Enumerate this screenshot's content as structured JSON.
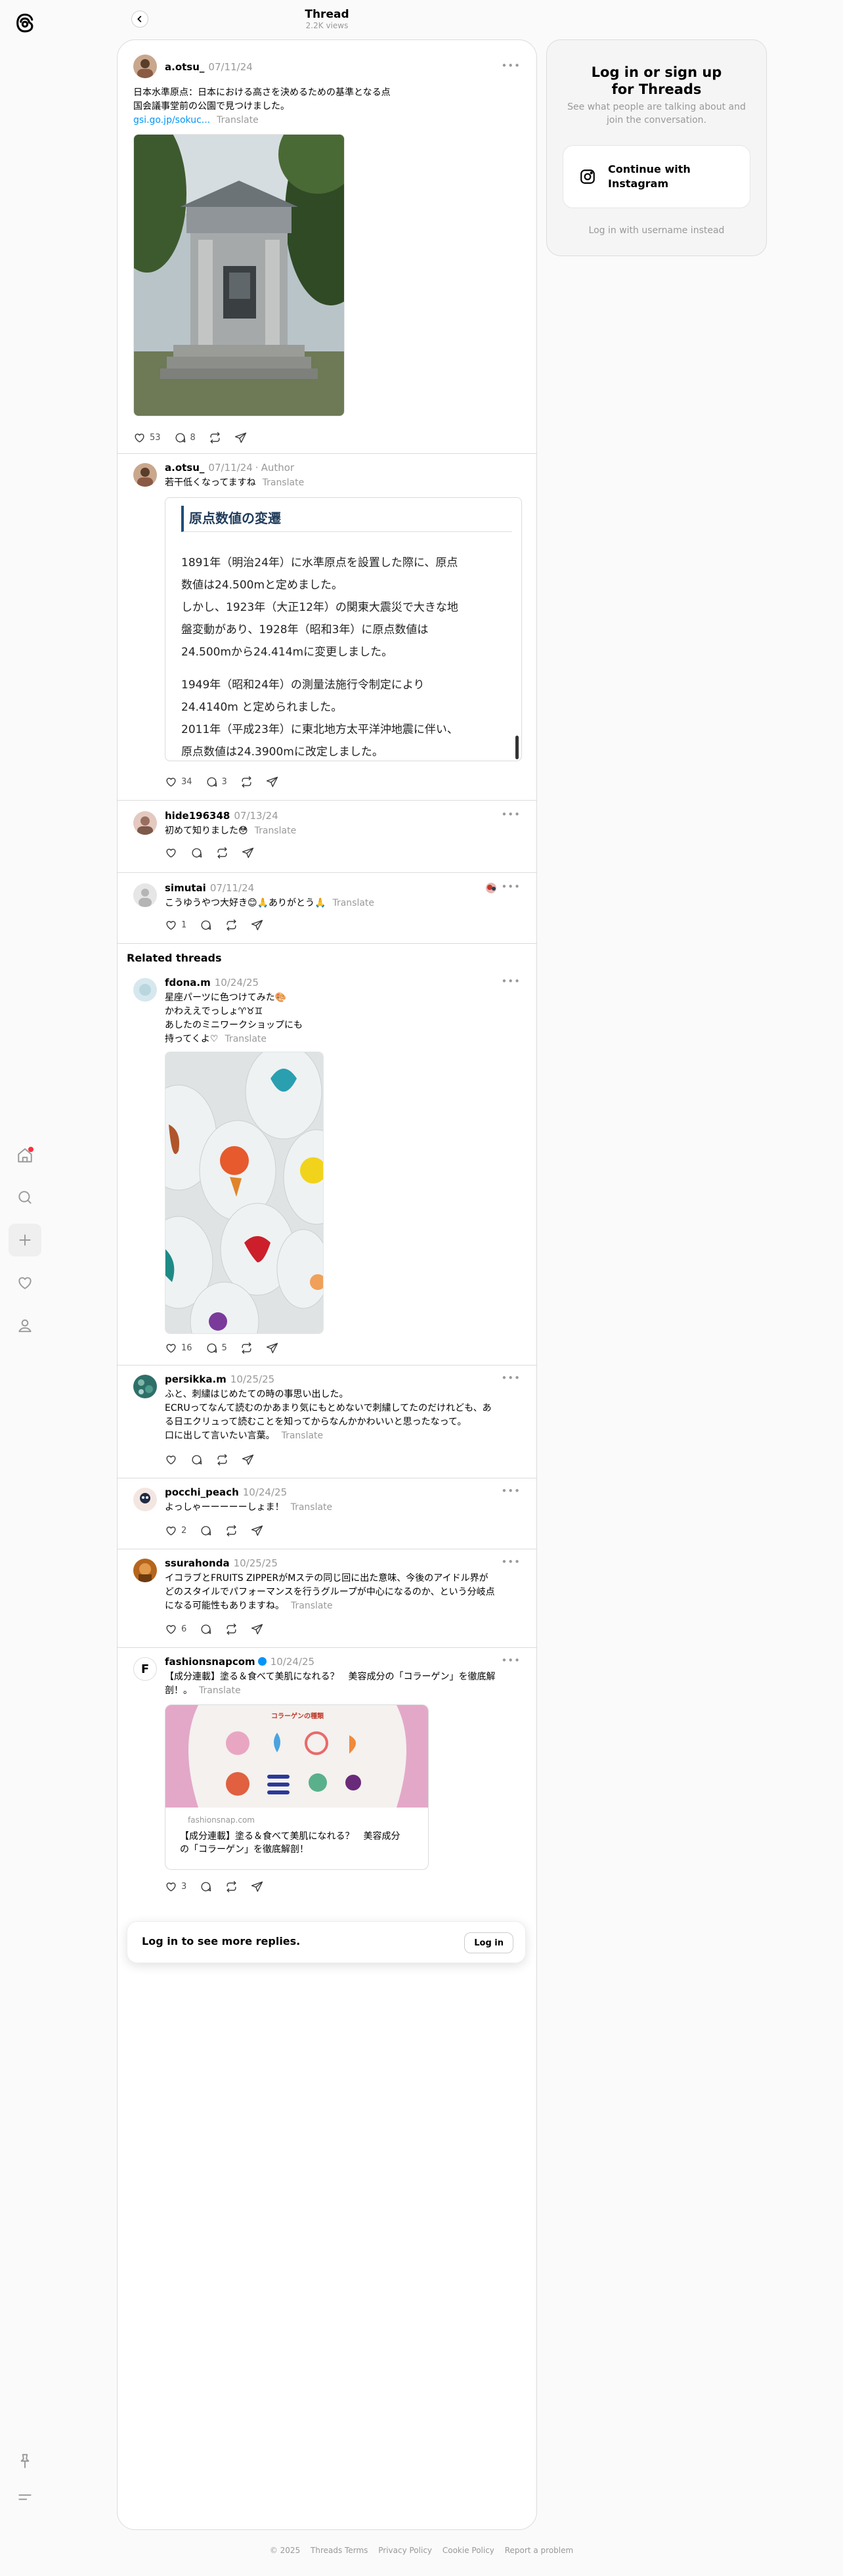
{
  "header": {
    "title": "Thread",
    "views": "2.2K views"
  },
  "nav": {
    "icons": [
      "threads-logo-icon",
      "home-icon",
      "search-icon",
      "create-icon",
      "activity-icon",
      "profile-icon",
      "pin-icon",
      "menu-icon"
    ]
  },
  "panel": {
    "title": "Log in or sign up for Threads",
    "subtitle": "See what people are talking about and join the conversation.",
    "ig_button": "Continue with Instagram",
    "alt_login": "Log in with username instead"
  },
  "main_post": {
    "username": "a.otsu_",
    "date": "07/11/24",
    "line1": "日本水準原点：日本における高さを決めるための基準となる点",
    "line2": "国会議事堂前の公園で見つけました。",
    "link": "gsi.go.jp/sokuc...",
    "translate": "Translate",
    "likes": "53",
    "replies": "8"
  },
  "author_reply": {
    "username": "a.otsu_",
    "date": "07/11/24",
    "tag": "Author",
    "text": "若干低くなってますね",
    "translate": "Translate",
    "quote_title": "原点数値の変遷",
    "quote_lines": [
      "1891年（明治24年）に水準原点を設置した際に、原点",
      "数値は24.500mと定めました。",
      "しかし、1923年（大正12年）の関東大震災で大きな地",
      "盤変動があり、1928年（昭和3年）に原点数値は",
      "24.500mから24.414mに変更しました。",
      "1949年（昭和24年）の測量法施行令制定により",
      "24.4140m と定められました。",
      "2011年（平成23年）に東北地方太平洋沖地震に伴い、",
      "原点数値は24.3900mに改定しました。"
    ],
    "likes": "34",
    "replies": "3"
  },
  "reply_hide": {
    "username": "hide196348",
    "date": "07/13/24",
    "text": "初めて知りました😳",
    "translate": "Translate"
  },
  "reply_simutai": {
    "username": "simutai",
    "date": "07/11/24",
    "text": "こうゆうやつ大好き😊🙏ありがとう🙏",
    "translate": "Translate",
    "likes": "1"
  },
  "related_title": "Related threads",
  "fdona": {
    "username": "fdona.m",
    "date": "10/24/25",
    "lines": [
      "星座パーツに色つけてみた🎨",
      "かわええでっしょ♈♉♊",
      "あしたのミニワークショップにも",
      "持ってくよ♡"
    ],
    "translate": "Translate",
    "likes": "16",
    "replies": "5"
  },
  "persikka": {
    "username": "persikka.m",
    "date": "10/25/25",
    "lines": [
      "ふと、刺繍はじめたての時の事思い出した。",
      "ECRUってなんて読むのかあまり気にもとめないで刺繍してたのだけれども、あ",
      "る日エクリュって読むことを知ってからなんかかわいいと思ったなって。",
      "口に出して言いたい言葉。"
    ],
    "translate": "Translate"
  },
  "pocchi": {
    "username": "pocchi_peach",
    "date": "10/24/25",
    "text": "よっしゃーーーーーしょま！",
    "translate": "Translate",
    "likes": "2"
  },
  "ssurahonda": {
    "username": "ssurahonda",
    "date": "10/25/25",
    "lines": [
      "イコラブとFRUITS ZIPPERがMステの同じ回に出た意味、今後のアイドル界が",
      "どのスタイルでパフォーマンスを行うグループが中心になるのか、という分岐点",
      "になる可能性もありますね。"
    ],
    "translate": "Translate",
    "likes": "6"
  },
  "fashion": {
    "username": "fashionsnapcom",
    "date": "10/24/25",
    "lines": [
      "【成分連載】塗る＆食べて美肌になれる？　美容成分の「コラーゲン」を徹底解",
      "剖！。"
    ],
    "translate": "Translate",
    "card_domain": "fashionsnap.com",
    "card_title_1": "【成分連載】塗る＆食べて美肌になれる？　美容成分",
    "card_title_2": "の「コラーゲン」を徹底解剖！",
    "card_banner": "コラーゲンの種類",
    "likes": "3"
  },
  "login_bar": {
    "text": "Log in to see more replies.",
    "button": "Log in"
  },
  "footer": [
    "© 2025",
    "Threads Terms",
    "Privacy Policy",
    "Cookie Policy",
    "Report a problem"
  ],
  "colors": {
    "link": "#0095f6",
    "muted": "#999999",
    "border": "#dbdbdb",
    "notif": "#ff3040"
  }
}
